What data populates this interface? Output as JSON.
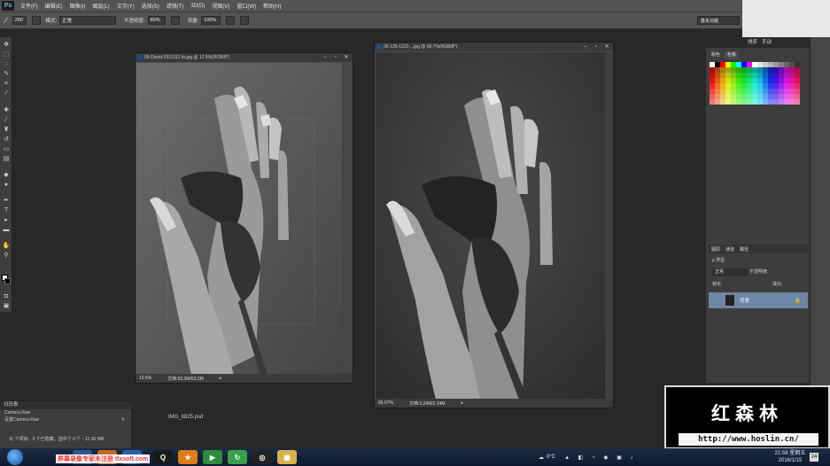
{
  "app": {
    "logo": "Ps",
    "workspace": "基本功能"
  },
  "menu": [
    "文件(F)",
    "编辑(E)",
    "图像(I)",
    "图层(L)",
    "文字(Y)",
    "选择(S)",
    "滤镜(T)",
    "3D(D)",
    "视图(V)",
    "窗口(W)",
    "帮助(H)"
  ],
  "options": {
    "brush_size": "250",
    "mode_label": "模式:",
    "mode_value": "正常",
    "opacity_label": "不透明度:",
    "opacity_value": "80%",
    "flow_label": "流量:",
    "flow_value": "100%"
  },
  "doc1": {
    "title": "06-David-2015111 fa.jpg @ 12.5%(RGB/8*)",
    "zoom": "12.5%",
    "info": "文档:63.2M/63.2M"
  },
  "doc2": {
    "title": "05-125-1222-...jpg @ 66.7%(RGB/8*)",
    "zoom": "66.67%",
    "info": "文档:2.24M/2.24M"
  },
  "panels": {
    "top_tabs": [
      "排序",
      "手动"
    ],
    "color_tabs": [
      "颜色",
      "色板"
    ],
    "layers_tabs": [
      "图层",
      "通道",
      "路径"
    ],
    "layers_kind": "ρ 类型",
    "blend_mode": "正常",
    "opacity_label": "不透明度:",
    "lock_label": "锁定:",
    "fill_label": "填充:",
    "layer_name": "背景"
  },
  "mini_panel": {
    "title": "日历表",
    "rows": [
      {
        "label": "Camera Raw",
        "num": ""
      },
      {
        "label": "设置Camera Raw",
        "num": "9"
      },
      {
        "label": "",
        "num": ""
      }
    ]
  },
  "file_label": "IMG_6825.psd",
  "bottom_status": "11 个项目，0 个已隐藏，选中了 0 个 - 12.96 MB",
  "watermark": {
    "name": "红森林",
    "url": "http://www.hoslin.cn/"
  },
  "taskbar": {
    "banner": "屏幕录像专家未注册 tlxsoft.com",
    "tray_temp": "0°C",
    "time": "21:58 星期五",
    "date": "2016/1/15",
    "notif_count": "24"
  },
  "colors": {
    "swatches": [
      "#ffffff",
      "#000000",
      "#ff0000",
      "#ffff00",
      "#00ff00",
      "#00ffff",
      "#0000ff",
      "#ff00ff",
      "#ffffff",
      "#e6e6e6",
      "#cccccc",
      "#b3b3b3",
      "#999999",
      "#808080",
      "#666666",
      "#4d4d4d",
      "#333333"
    ]
  }
}
